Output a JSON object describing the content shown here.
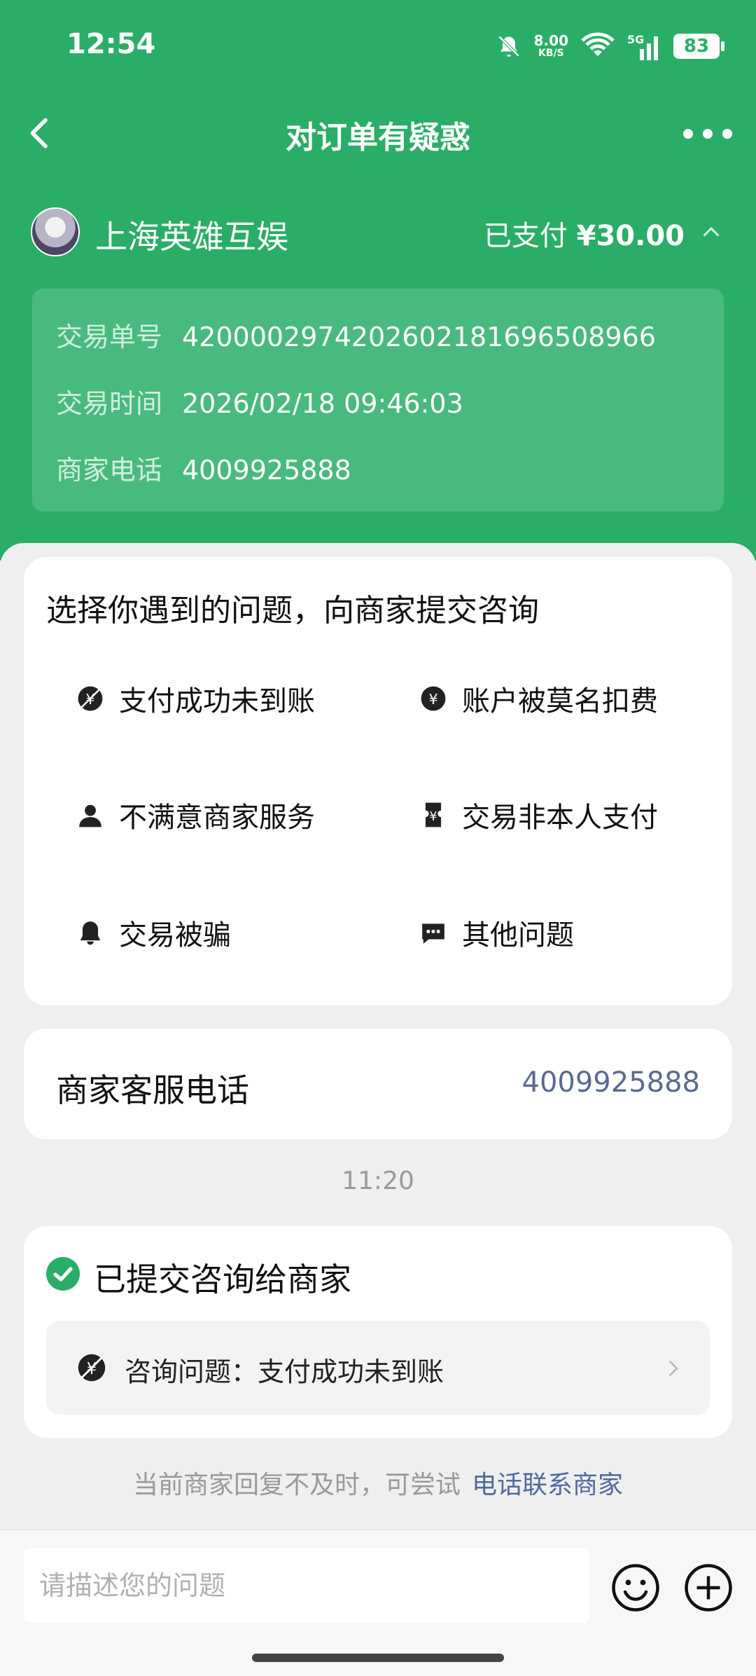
{
  "status_bar": {
    "time": "12:54",
    "net_speed": "8.00",
    "net_unit": "KB/S",
    "battery": "83"
  },
  "header": {
    "title": "对订单有疑惑"
  },
  "merchant": {
    "name": "上海英雄互娱",
    "paid_label": "已支付",
    "amount": "¥30.00",
    "details": [
      {
        "key": "交易单号",
        "value": "4200002974202602181696508966"
      },
      {
        "key": "交易时间",
        "value": "2026/02/18 09:46:03"
      },
      {
        "key": "商家电话",
        "value": "4009925888"
      }
    ]
  },
  "issues": {
    "title": "选择你遇到的问题，向商家提交咨询",
    "options": [
      {
        "label": "支付成功未到账",
        "icon": "yen-slash-icon"
      },
      {
        "label": "账户被莫名扣费",
        "icon": "yen-circle-icon"
      },
      {
        "label": "不满意商家服务",
        "icon": "person-icon"
      },
      {
        "label": "交易非本人支付",
        "icon": "ticket-yen-icon"
      },
      {
        "label": "交易被骗",
        "icon": "bell-icon"
      },
      {
        "label": "其他问题",
        "icon": "chat-dots-icon"
      }
    ]
  },
  "service_phone": {
    "label": "商家客服电话",
    "number": "4009925888"
  },
  "timestamp": "11:20",
  "submission": {
    "title": "已提交咨询给商家",
    "question": "咨询问题：支付成功未到账"
  },
  "hint": {
    "text": "当前商家回复不及时，可尝试",
    "link": "电话联系商家"
  },
  "input": {
    "placeholder": "请描述您的问题"
  },
  "colors": {
    "brand": "#2aae67",
    "link": "#4d6aa0"
  }
}
